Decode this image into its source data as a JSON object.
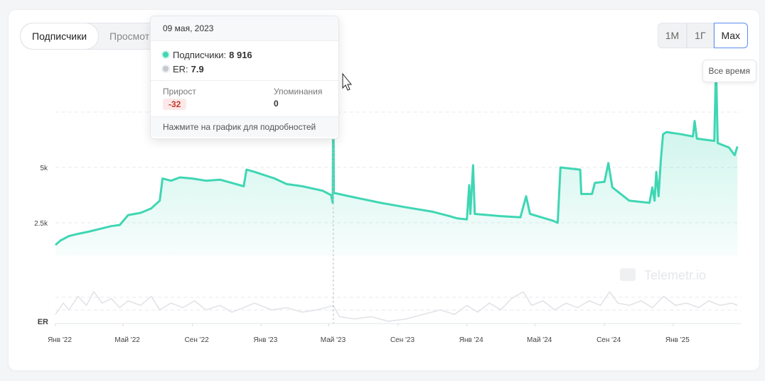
{
  "tabs": [
    "Подписчики",
    "Просмотры"
  ],
  "active_tab": 0,
  "range_buttons": [
    "1М",
    "1Г",
    "Max"
  ],
  "active_range": 2,
  "range_hint": "Все время",
  "watermark": "Telemetr.io",
  "tooltip": {
    "date": "09 мая, 2023",
    "series": [
      {
        "label": "Подписчики:",
        "value": "8 916",
        "color": "#3fd6b4"
      },
      {
        "label": "ER:",
        "value": "7.9",
        "color": "#c5c9cf"
      }
    ],
    "growth_label": "Прирост",
    "growth_value": "-32",
    "mentions_label": "Упоминания",
    "mentions_value": "0",
    "footer": "Нажмите на график для подробностей"
  },
  "colors": {
    "line": "#3fd6b4",
    "er": "#dfe2e6",
    "accent": "#5b8def"
  },
  "chart_data": {
    "type": "area",
    "y_ticks": [
      "5k",
      "2.5k"
    ],
    "er_label": "ER",
    "x_ticks": [
      "Янв '22",
      "Май '22",
      "Сен '22",
      "Янв '23",
      "Май '23",
      "Сен '23",
      "Янв '24",
      "Май '24",
      "Сен '24",
      "Янв '25"
    ],
    "x_tick_dates": [
      "2022-01-01",
      "2022-05-01",
      "2022-09-01",
      "2023-01-01",
      "2023-05-01",
      "2023-09-01",
      "2024-01-01",
      "2024-05-01",
      "2024-09-01",
      "2025-01-01"
    ],
    "y_ticks_values": [
      5000,
      2500
    ],
    "series": [
      {
        "points": [
          [
            "2022-01-01",
            1500
          ],
          [
            "2022-01-10",
            1700
          ],
          [
            "2022-01-25",
            1900
          ],
          [
            "2022-02-10",
            2000
          ],
          [
            "2022-03-01",
            2100
          ],
          [
            "2022-03-25",
            2250
          ],
          [
            "2022-04-10",
            2350
          ],
          [
            "2022-04-25",
            2400
          ],
          [
            "2022-05-10",
            2850
          ],
          [
            "2022-06-01",
            2950
          ],
          [
            "2022-06-20",
            3150
          ],
          [
            "2022-07-05",
            3500
          ],
          [
            "2022-07-10",
            4500
          ],
          [
            "2022-07-25",
            4400
          ],
          [
            "2022-08-10",
            4550
          ],
          [
            "2022-09-01",
            4500
          ],
          [
            "2022-09-25",
            4400
          ],
          [
            "2022-10-20",
            4450
          ],
          [
            "2022-11-10",
            4300
          ],
          [
            "2022-12-01",
            4150
          ],
          [
            "2022-12-06",
            4900
          ],
          [
            "2022-12-20",
            4800
          ],
          [
            "2023-01-25",
            4500
          ],
          [
            "2023-02-15",
            4250
          ],
          [
            "2023-03-15",
            4150
          ],
          [
            "2023-04-20",
            3950
          ],
          [
            "2023-05-05",
            3750
          ],
          [
            "2023-05-08",
            3400
          ],
          [
            "2023-05-09",
            8916
          ],
          [
            "2023-05-10",
            3850
          ],
          [
            "2023-06-15",
            3650
          ],
          [
            "2023-08-01",
            3400
          ],
          [
            "2023-09-15",
            3200
          ],
          [
            "2023-11-01",
            3000
          ],
          [
            "2023-12-01",
            2800
          ],
          [
            "2023-12-15",
            2700
          ],
          [
            "2024-01-01",
            2650
          ],
          [
            "2024-01-05",
            4200
          ],
          [
            "2024-01-07",
            2900
          ],
          [
            "2024-01-12",
            5100
          ],
          [
            "2024-01-15",
            2900
          ],
          [
            "2024-03-01",
            2800
          ],
          [
            "2024-04-05",
            2750
          ],
          [
            "2024-04-15",
            3700
          ],
          [
            "2024-04-22",
            2900
          ],
          [
            "2024-06-01",
            2600
          ],
          [
            "2024-06-10",
            2500
          ],
          [
            "2024-06-15",
            5000
          ],
          [
            "2024-07-20",
            4900
          ],
          [
            "2024-07-22",
            3800
          ],
          [
            "2024-08-10",
            3800
          ],
          [
            "2024-08-15",
            4300
          ],
          [
            "2024-09-01",
            4350
          ],
          [
            "2024-09-08",
            5200
          ],
          [
            "2024-09-15",
            4100
          ],
          [
            "2024-10-15",
            3500
          ],
          [
            "2024-11-20",
            3400
          ],
          [
            "2024-11-25",
            4100
          ],
          [
            "2024-11-29",
            3500
          ],
          [
            "2024-12-02",
            4800
          ],
          [
            "2024-12-06",
            3700
          ],
          [
            "2024-12-10",
            5300
          ],
          [
            "2024-12-14",
            6500
          ],
          [
            "2024-12-20",
            6600
          ],
          [
            "2025-01-15",
            6500
          ],
          [
            "2025-02-05",
            6400
          ],
          [
            "2025-02-08",
            7100
          ],
          [
            "2025-02-12",
            6300
          ],
          [
            "2025-03-15",
            6200
          ],
          [
            "2025-03-18",
            9700
          ],
          [
            "2025-03-21",
            6100
          ],
          [
            "2025-04-10",
            5900
          ],
          [
            "2025-04-20",
            5550
          ],
          [
            "2025-04-25",
            5950
          ]
        ]
      }
    ],
    "er_series": [
      [
        "2022-01-01",
        4
      ],
      [
        "2022-01-15",
        9
      ],
      [
        "2022-01-25",
        6
      ],
      [
        "2022-02-10",
        12
      ],
      [
        "2022-02-25",
        8
      ],
      [
        "2022-03-10",
        14
      ],
      [
        "2022-03-25",
        9
      ],
      [
        "2022-04-10",
        11
      ],
      [
        "2022-04-25",
        7
      ],
      [
        "2022-05-10",
        10
      ],
      [
        "2022-06-01",
        8
      ],
      [
        "2022-06-20",
        12
      ],
      [
        "2022-07-05",
        6
      ],
      [
        "2022-07-25",
        9
      ],
      [
        "2022-08-15",
        7
      ],
      [
        "2022-09-05",
        10
      ],
      [
        "2022-09-25",
        6
      ],
      [
        "2022-10-20",
        8
      ],
      [
        "2022-11-10",
        5
      ],
      [
        "2022-12-01",
        7
      ],
      [
        "2022-12-20",
        9
      ],
      [
        "2023-01-20",
        6
      ],
      [
        "2023-02-15",
        7
      ],
      [
        "2023-03-15",
        5
      ],
      [
        "2023-04-10",
        6
      ],
      [
        "2023-05-09",
        7.9
      ],
      [
        "2023-05-20",
        3
      ],
      [
        "2023-06-15",
        2
      ],
      [
        "2023-07-15",
        3
      ],
      [
        "2023-08-15",
        1
      ],
      [
        "2023-09-15",
        2
      ],
      [
        "2023-10-15",
        4
      ],
      [
        "2023-11-15",
        6
      ],
      [
        "2023-12-10",
        4
      ],
      [
        "2024-01-01",
        8
      ],
      [
        "2024-01-20",
        5
      ],
      [
        "2024-02-10",
        9
      ],
      [
        "2024-03-01",
        6
      ],
      [
        "2024-03-20",
        11
      ],
      [
        "2024-04-10",
        14
      ],
      [
        "2024-04-25",
        8
      ],
      [
        "2024-05-15",
        10
      ],
      [
        "2024-06-05",
        6
      ],
      [
        "2024-06-25",
        9
      ],
      [
        "2024-07-15",
        7
      ],
      [
        "2024-08-05",
        10
      ],
      [
        "2024-08-25",
        8
      ],
      [
        "2024-09-10",
        14
      ],
      [
        "2024-09-25",
        9
      ],
      [
        "2024-10-15",
        8
      ],
      [
        "2024-11-05",
        10
      ],
      [
        "2024-11-25",
        7
      ],
      [
        "2024-12-15",
        12
      ],
      [
        "2025-01-05",
        8
      ],
      [
        "2025-01-25",
        9
      ],
      [
        "2025-02-15",
        7
      ],
      [
        "2025-03-05",
        10
      ],
      [
        "2025-03-25",
        8
      ],
      [
        "2025-04-15",
        9
      ],
      [
        "2025-04-25",
        8
      ]
    ],
    "hover_date": "2023-05-09",
    "grid": true
  }
}
